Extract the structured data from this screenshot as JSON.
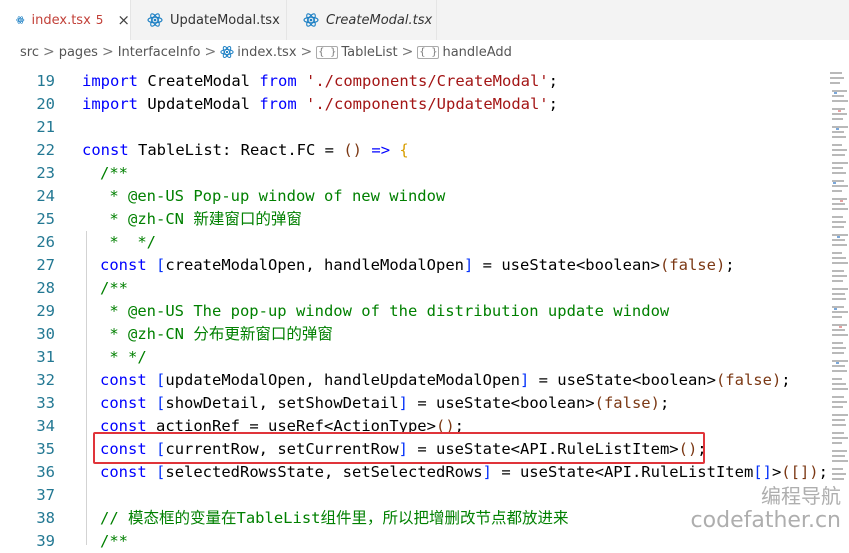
{
  "tabs": [
    {
      "name": "index.tsx",
      "badge": "5",
      "close": "×",
      "active": true,
      "italic": false
    },
    {
      "name": "UpdateModal.tsx",
      "active": false,
      "italic": false
    },
    {
      "name": "CreateModal.tsx",
      "active": false,
      "italic": true
    }
  ],
  "breadcrumb": {
    "items": [
      "src",
      "pages",
      "InterfaceInfo",
      "index.tsx",
      "TableList",
      "handleAdd"
    ],
    "separator": ">",
    "symbol_label": "{ }"
  },
  "editor": {
    "line_numbers": [
      "19",
      "20",
      "21",
      "22",
      "23",
      "24",
      "25",
      "26",
      "27",
      "28",
      "29",
      "30",
      "31",
      "32",
      "33",
      "34",
      "35",
      "36",
      "37",
      "38",
      "39"
    ],
    "lines": {
      "l19": {
        "kw": "import",
        "name": "CreateModal",
        "from": "from",
        "str": "'./components/CreateModal'",
        "semi": ";"
      },
      "l20": {
        "kw": "import",
        "name": "UpdateModal",
        "from": "from",
        "str": "'./components/UpdateModal'",
        "semi": ";"
      },
      "l22": {
        "kw": "const",
        "name": "TableList",
        "colon": ": React.FC =",
        "open": "()",
        "arrow": "=>",
        "brace": "{"
      },
      "l23": "/**",
      "l24": " * @en-US Pop-up window of new window",
      "l25": " * @zh-CN 新建窗口的弹窗",
      "l26": " *  */",
      "l27": {
        "kw": "const",
        "lb": "[",
        "vars": "createModalOpen, handleModalOpen",
        "rb": "]",
        "eq": " = useState<boolean>",
        "call": "(false)",
        "semi": ";"
      },
      "l28": "/**",
      "l29": " * @en-US The pop-up window of the distribution update window",
      "l30": " * @zh-CN 分布更新窗口的弹窗",
      "l31": " * */",
      "l32": {
        "kw": "const",
        "lb": "[",
        "vars": "updateModalOpen, handleUpdateModalOpen",
        "rb": "]",
        "eq": " = useState<boolean>",
        "call": "(false)",
        "semi": ";"
      },
      "l33": {
        "kw": "const",
        "lb": "[",
        "vars": "showDetail, setShowDetail",
        "rb": "]",
        "eq": " = useState<boolean>",
        "call": "(false)",
        "semi": ";"
      },
      "l34": {
        "kw": "const",
        "rest": "actionRef = useRef<ActionType>",
        "call": "()",
        "semi": ";"
      },
      "l35": {
        "kw": "const",
        "lb": "[",
        "vars": "currentRow, setCurrentRow",
        "rb": "]",
        "eq": " = useState<API.RuleListItem>",
        "call": "()",
        "semi": ";"
      },
      "l36": {
        "kw": "const",
        "lb": "[",
        "vars": "selectedRowsState, setSelectedRows",
        "rb": "]",
        "eq": " = useState<API.RuleListItem",
        "arr": "[]",
        "gt": ">",
        "call": "([])",
        "semi": ";"
      },
      "l38": "// 模态框的变量在TableList组件里，所以把增删改节点都放进来",
      "l39": "/**"
    }
  },
  "watermark": {
    "line1": "编程导航",
    "line2": "codefather.cn"
  },
  "colors": {
    "keyword": "#0000ff",
    "string": "#a31515",
    "comment": "#008000",
    "line_number": "#237893",
    "highlight_box": "#e0343a"
  }
}
